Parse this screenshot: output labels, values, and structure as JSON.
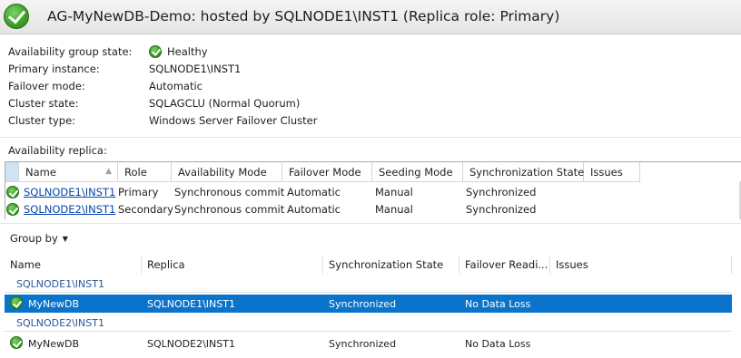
{
  "header": {
    "title": "AG-MyNewDB-Demo: hosted by SQLNODE1\\INST1 (Replica role: Primary)",
    "status_icon": "green-check-icon"
  },
  "properties": {
    "ag_state_label": "Availability group state:",
    "ag_state_value": "Healthy",
    "primary_label": "Primary instance:",
    "primary_value": "SQLNODE1\\INST1",
    "failover_label": "Failover mode:",
    "failover_value": "Automatic",
    "cluster_state_label": "Cluster state:",
    "cluster_state_value": "SQLAGCLU (Normal Quorum)",
    "cluster_type_label": "Cluster type:",
    "cluster_type_value": "Windows Server Failover Cluster"
  },
  "replicas": {
    "section_label": "Availability replica:",
    "columns": [
      "Name",
      "Role",
      "Availability Mode",
      "Failover Mode",
      "Seeding Mode",
      "Synchronization State",
      "Issues"
    ],
    "rows": [
      {
        "name": "SQLNODE1\\INST1",
        "role": "Primary",
        "availability_mode": "Synchronous commit",
        "failover_mode": "Automatic",
        "seeding_mode": "Manual",
        "sync_state": "Synchronized",
        "issues": ""
      },
      {
        "name": "SQLNODE2\\INST1",
        "role": "Secondary",
        "availability_mode": "Synchronous commit",
        "failover_mode": "Automatic",
        "seeding_mode": "Manual",
        "sync_state": "Synchronized",
        "issues": ""
      }
    ]
  },
  "databases": {
    "group_by_label": "Group by",
    "columns": [
      "Name",
      "Replica",
      "Synchronization State",
      "Failover Readi...",
      "Issues"
    ],
    "groups": [
      {
        "label": "SQLNODE1\\INST1",
        "rows": [
          {
            "name": "MyNewDB",
            "replica": "SQLNODE1\\INST1",
            "sync_state": "Synchronized",
            "failover_readiness": "No Data Loss",
            "issues": ""
          }
        ]
      },
      {
        "label": "SQLNODE2\\INST1",
        "rows": [
          {
            "name": "MyNewDB",
            "replica": "SQLNODE2\\INST1",
            "sync_state": "Synchronized",
            "failover_readiness": "No Data Loss",
            "issues": ""
          }
        ]
      }
    ],
    "selected_row": "MyNewDB (SQLNODE1\\INST1)"
  },
  "colors": {
    "selection": "#0a74cc",
    "link": "#0645ad",
    "group_label": "#2b579a",
    "status_green": "#3ea12a"
  }
}
